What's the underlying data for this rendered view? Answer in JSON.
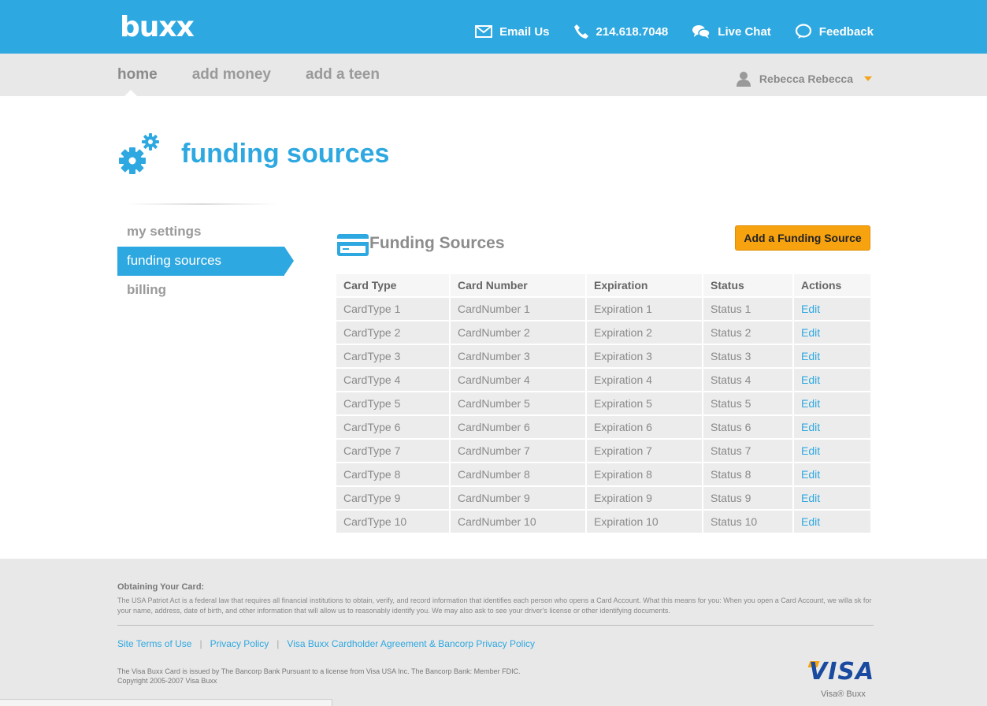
{
  "header": {
    "logo": "buxx",
    "links": [
      {
        "label": "Email Us",
        "icon": "envelope-icon"
      },
      {
        "label": "214.618.7048",
        "icon": "phone-icon"
      },
      {
        "label": "Live Chat",
        "icon": "chat-bubbles-icon"
      },
      {
        "label": "Feedback",
        "icon": "speech-bubble-icon"
      }
    ]
  },
  "nav": {
    "items": [
      "home",
      "add money",
      "add a teen"
    ],
    "active": "home",
    "user_name": "Rebecca Rebecca"
  },
  "page": {
    "title": "funding sources"
  },
  "sidebar": {
    "items": [
      "my settings",
      "funding sources",
      "billing"
    ],
    "active": "funding sources"
  },
  "section": {
    "title": "Funding Sources",
    "add_button": "Add a Funding Source"
  },
  "table": {
    "columns": [
      "Card Type",
      "Card Number",
      "Expiration",
      "Status",
      "Actions"
    ],
    "rows": [
      [
        "CardType 1",
        "CardNumber 1",
        "Expiration 1",
        "Status 1",
        "Edit"
      ],
      [
        "CardType 2",
        "CardNumber 2",
        "Expiration 2",
        "Status 2",
        "Edit"
      ],
      [
        "CardType 3",
        "CardNumber 3",
        "Expiration 3",
        "Status 3",
        "Edit"
      ],
      [
        "CardType 4",
        "CardNumber 4",
        "Expiration 4",
        "Status 4",
        "Edit"
      ],
      [
        "CardType 5",
        "CardNumber 5",
        "Expiration 5",
        "Status 5",
        "Edit"
      ],
      [
        "CardType 6",
        "CardNumber 6",
        "Expiration 6",
        "Status 6",
        "Edit"
      ],
      [
        "CardType 7",
        "CardNumber 7",
        "Expiration 7",
        "Status 7",
        "Edit"
      ],
      [
        "CardType 8",
        "CardNumber 8",
        "Expiration 8",
        "Status 8",
        "Edit"
      ],
      [
        "CardType 9",
        "CardNumber 9",
        "Expiration 9",
        "Status 9",
        "Edit"
      ],
      [
        "CardType 10",
        "CardNumber 10",
        "Expiration 10",
        "Status 10",
        "Edit"
      ]
    ]
  },
  "footer": {
    "heading": "Obtaining Your Card:",
    "body": "The USA Patriot Act is a federal law that requires all financial institutions to obtain, verify, and record information that identifies each person who opens a Card Account. What this means for you: When you open a Card Account, we willa sk for your name, address, date of birth, and other information that will allow us to reasonably identify you. We may also ask to see your driver's license or other identifying documents.",
    "links": [
      "Site Terms of Use",
      "Privacy Policy",
      "Visa Buxx Cardholder Agreement & Bancorp Privacy Policy"
    ],
    "legal_line1": "The Visa Buxx Card is issued by The Bancorp Bank Pursuant to a license from Visa USA Inc. The Bancorp Bank: Member FDIC.",
    "legal_line2": "Copyright 2005-2007 Visa Buxx",
    "visa_logo": "VISA",
    "visa_sub": "Visa® Buxx"
  },
  "colors": {
    "brand_blue": "#2ea8e0",
    "accent_orange": "#f7a20f"
  }
}
